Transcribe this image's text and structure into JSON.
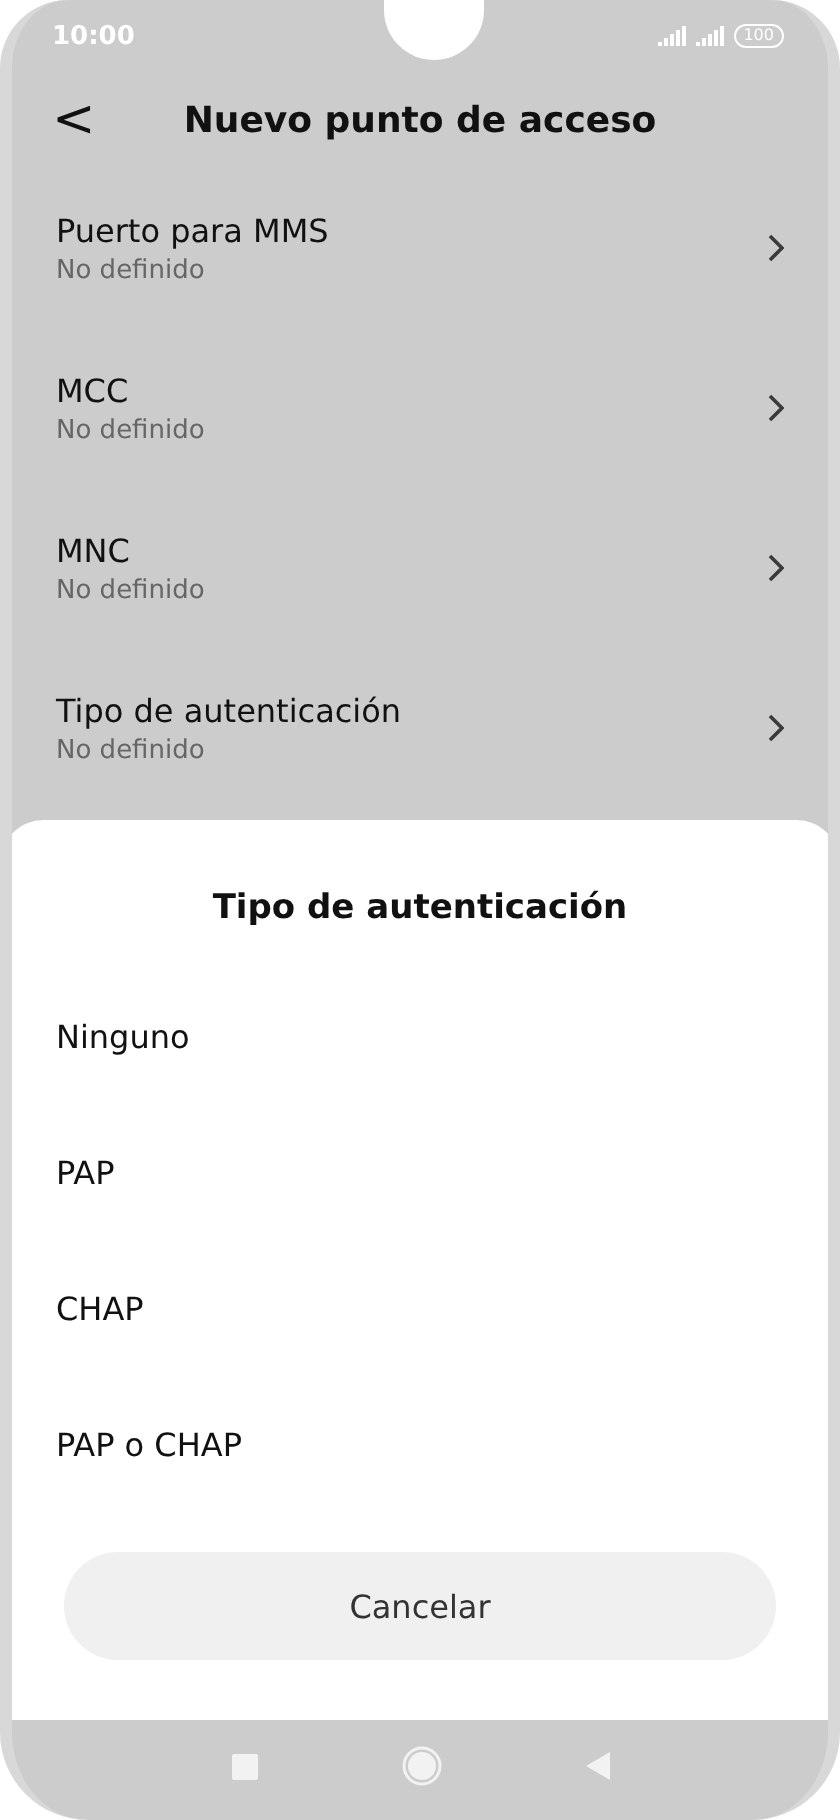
{
  "status_bar": {
    "time": "10:00",
    "battery": "100"
  },
  "header": {
    "back": "<",
    "title": "Nuevo punto de acceso"
  },
  "settings": [
    {
      "title": "Puerto para MMS",
      "value": "No definido"
    },
    {
      "title": "MCC",
      "value": "No definido"
    },
    {
      "title": "MNC",
      "value": "No definido"
    },
    {
      "title": "Tipo de autenticación",
      "value": "No definido"
    }
  ],
  "dialog": {
    "title": "Tipo de autenticación",
    "options": [
      {
        "label": "Ninguno"
      },
      {
        "label": "PAP"
      },
      {
        "label": "CHAP"
      },
      {
        "label": "PAP o CHAP"
      }
    ],
    "cancel": "Cancelar"
  }
}
